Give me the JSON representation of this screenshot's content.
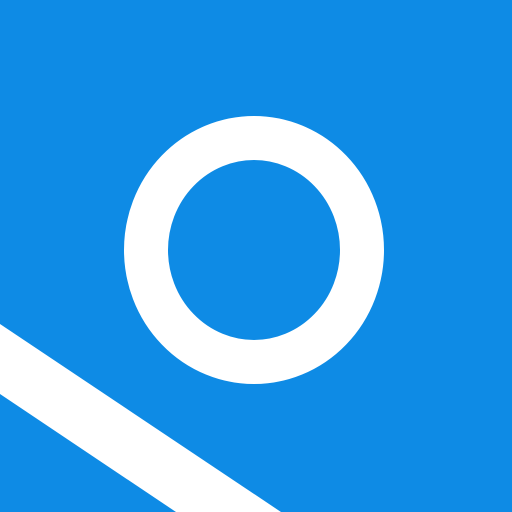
{
  "icon": {
    "name": "circle-and-stripe-logo",
    "background_color": "#0E8BE5",
    "foreground_color": "#FFFFFF"
  }
}
